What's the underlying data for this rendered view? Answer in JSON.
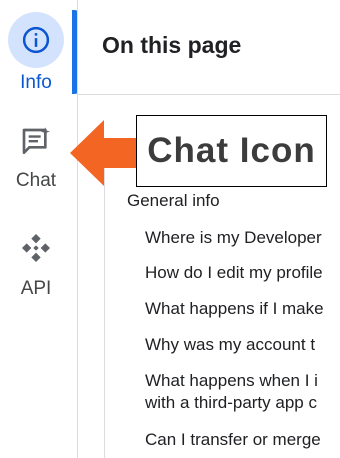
{
  "rail": {
    "items": [
      {
        "label": "Info",
        "icon": "info-icon",
        "active": true
      },
      {
        "label": "Chat",
        "icon": "chat-icon",
        "active": false
      },
      {
        "label": "API",
        "icon": "api-icon",
        "active": false
      }
    ]
  },
  "panel": {
    "title": "On this page",
    "section": "General info",
    "items": [
      "Where is my Developer",
      "How do I edit my profile",
      "What happens if I make",
      "Why was my account t",
      "What happens when I i",
      "with a third-party app c",
      "Can I transfer or merge"
    ]
  },
  "callout": {
    "label": "Chat Icon"
  },
  "colors": {
    "accent": "#0b57d0",
    "active_bg": "#d3e3fd",
    "indicator": "#1a73e8",
    "arrow": "#f26522"
  }
}
